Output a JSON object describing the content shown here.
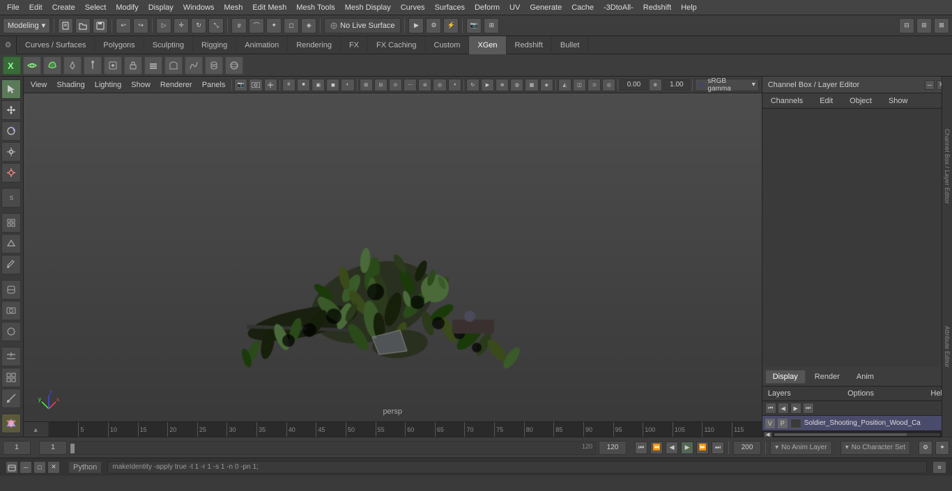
{
  "app": {
    "title": "Autodesk Maya"
  },
  "menu_bar": {
    "items": [
      {
        "label": "File",
        "id": "file"
      },
      {
        "label": "Edit",
        "id": "edit"
      },
      {
        "label": "Create",
        "id": "create"
      },
      {
        "label": "Select",
        "id": "select"
      },
      {
        "label": "Modify",
        "id": "modify"
      },
      {
        "label": "Display",
        "id": "display"
      },
      {
        "label": "Windows",
        "id": "windows"
      },
      {
        "label": "Mesh",
        "id": "mesh"
      },
      {
        "label": "Edit Mesh",
        "id": "edit-mesh"
      },
      {
        "label": "Mesh Tools",
        "id": "mesh-tools"
      },
      {
        "label": "Mesh Display",
        "id": "mesh-display"
      },
      {
        "label": "Curves",
        "id": "curves"
      },
      {
        "label": "Surfaces",
        "id": "surfaces"
      },
      {
        "label": "Deform",
        "id": "deform"
      },
      {
        "label": "UV",
        "id": "uv"
      },
      {
        "label": "Generate",
        "id": "generate"
      },
      {
        "label": "Cache",
        "id": "cache"
      },
      {
        "label": "-3DtoAll-",
        "id": "3dtoall"
      },
      {
        "label": "Redshift",
        "id": "redshift"
      },
      {
        "label": "Help",
        "id": "help"
      }
    ]
  },
  "toolbar1": {
    "mode_selector": {
      "label": "Modeling",
      "value": "Modeling"
    },
    "live_surface_btn": {
      "label": "No Live Surface"
    },
    "icons": [
      "new",
      "open",
      "save",
      "undo",
      "redo",
      "transform1",
      "transform2",
      "transform3",
      "snap1",
      "snap2",
      "snap3",
      "snap4",
      "snap5",
      "snap6",
      "snap7",
      "render1",
      "render2",
      "render3",
      "render4",
      "render5",
      "cam1",
      "cam2",
      "extra1",
      "extra2",
      "extra3"
    ]
  },
  "tab_bar": {
    "tabs": [
      {
        "label": "Curves / Surfaces",
        "active": false
      },
      {
        "label": "Polygons",
        "active": false
      },
      {
        "label": "Sculpting",
        "active": false
      },
      {
        "label": "Rigging",
        "active": false
      },
      {
        "label": "Animation",
        "active": false
      },
      {
        "label": "Rendering",
        "active": false
      },
      {
        "label": "FX",
        "active": false
      },
      {
        "label": "FX Caching",
        "active": false
      },
      {
        "label": "Custom",
        "active": false
      },
      {
        "label": "XGen",
        "active": true
      },
      {
        "label": "Redshift",
        "active": false
      },
      {
        "label": "Bullet",
        "active": false
      }
    ]
  },
  "xgen_toolbar": {
    "buttons": [
      "xg1",
      "xg2",
      "xg3",
      "xg4",
      "xg5",
      "xg6",
      "xg7",
      "xg8",
      "xg9",
      "xg10",
      "xg11",
      "xg12",
      "xg13",
      "xg14",
      "xg15",
      "xg16",
      "xg17",
      "xg18",
      "xg19",
      "xg20"
    ]
  },
  "viewport": {
    "menus": [
      "View",
      "Shading",
      "Lighting",
      "Show",
      "Renderer",
      "Panels"
    ],
    "persp_label": "persp",
    "gamma_label": "sRGB gamma",
    "value1": "0.00",
    "value2": "1.00"
  },
  "channel_box": {
    "header_title": "Channel Box / Layer Editor",
    "tabs": [
      "Channels",
      "Edit",
      "Object",
      "Show"
    ],
    "display_tabs": [
      "Display",
      "Render",
      "Anim"
    ],
    "active_display_tab": "Display",
    "layers_label": "Layers",
    "options_label": "Options",
    "help_label": "Help",
    "layer_name": "Soldier_Shooting_Position_Wood_Ca",
    "layer_v": "V",
    "layer_p": "P",
    "vertical_labels": [
      "Channel Box / Layer Editor",
      "Attribute Editor"
    ]
  },
  "timeline": {
    "markers": [
      {
        "pos": 5,
        "label": "5"
      },
      {
        "pos": 10,
        "label": "10"
      },
      {
        "pos": 15,
        "label": "15"
      },
      {
        "pos": 20,
        "label": "20"
      },
      {
        "pos": 25,
        "label": "25"
      },
      {
        "pos": 30,
        "label": "30"
      },
      {
        "pos": 35,
        "label": "35"
      },
      {
        "pos": 40,
        "label": "40"
      },
      {
        "pos": 45,
        "label": "45"
      },
      {
        "pos": 50,
        "label": "50"
      },
      {
        "pos": 55,
        "label": "55"
      },
      {
        "pos": 60,
        "label": "60"
      },
      {
        "pos": 65,
        "label": "65"
      },
      {
        "pos": 70,
        "label": "70"
      },
      {
        "pos": 75,
        "label": "75"
      },
      {
        "pos": 80,
        "label": "80"
      },
      {
        "pos": 85,
        "label": "85"
      },
      {
        "pos": 90,
        "label": "90"
      },
      {
        "pos": 95,
        "label": "95"
      },
      {
        "pos": 100,
        "label": "100"
      },
      {
        "pos": 105,
        "label": "105"
      },
      {
        "pos": 110,
        "label": "110"
      },
      {
        "pos": 115,
        "label": "115"
      },
      {
        "pos": 120,
        "label": "120"
      }
    ],
    "current_frame": "1",
    "range_start": "1",
    "range_end": "120",
    "playback_start": "1",
    "playback_end": "120",
    "max_frame": "200"
  },
  "bottom_bar": {
    "frame_display": "1",
    "frame_input": "1",
    "range_display": "1",
    "range_end": "120",
    "playback_end": "120",
    "max_frame": "200",
    "anim_layer": "No Anim Layer",
    "char_set": "No Character Set"
  },
  "status_bar": {
    "python_label": "Python",
    "command": "makeIdentity -apply true -t 1 -r 1 -s 1 -n 0 -pn 1;"
  }
}
